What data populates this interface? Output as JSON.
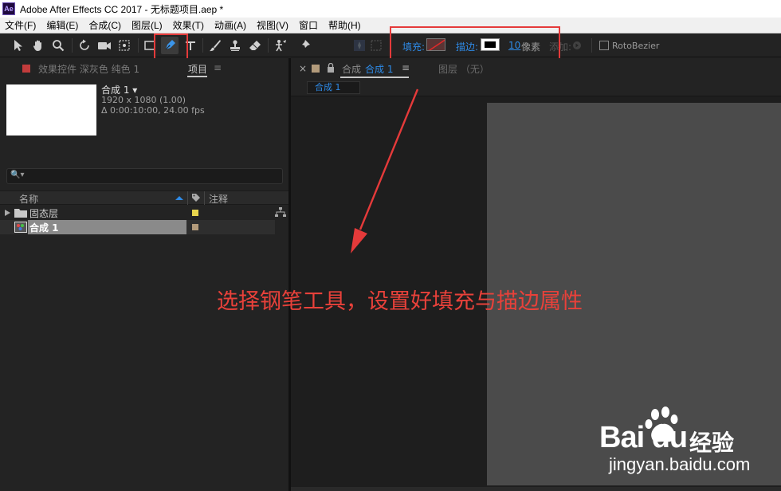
{
  "window": {
    "app_icon": "Ae",
    "title": "Adobe After Effects CC 2017 - 无标题项目.aep *"
  },
  "menu": {
    "items": [
      "文件(F)",
      "编辑(E)",
      "合成(C)",
      "图层(L)",
      "效果(T)",
      "动画(A)",
      "视图(V)",
      "窗口",
      "帮助(H)"
    ]
  },
  "toolbar": {
    "tools": [
      "selection-tool-icon",
      "hand-tool-icon",
      "zoom-tool-icon",
      "rotate-tool-icon",
      "camera-tool-icon",
      "pan-behind-tool-icon",
      "rectangle-tool-icon",
      "pen-tool-icon",
      "type-tool-icon",
      "brush-tool-icon",
      "clone-stamp-tool-icon",
      "eraser-tool-icon",
      "roto-brush-tool-icon",
      "puppet-pin-tool-icon"
    ],
    "active_tool": "pen-tool-icon",
    "fill_label": "填充:",
    "stroke_label": "描边:",
    "stroke_width": "10",
    "stroke_unit": "像素",
    "add_label": "添加:",
    "rotobezier_label": "RotoBezier"
  },
  "left_panel": {
    "tab_effects": "效果控件 深灰色 纯色 1",
    "tab_project": "项目",
    "menu_glyph": "≡",
    "preview": {
      "name": "合成 1 ▾",
      "resolution": "1920 x 1080 (1.00)",
      "duration": "Δ 0:00:10:00, 24.00 fps"
    },
    "search_icon": "🔍▾",
    "columns": {
      "name": "名称",
      "comment": "注释"
    },
    "rows": [
      {
        "name": "固态层",
        "type": "folder",
        "label_color": "#e8d44d"
      },
      {
        "name": "合成 1",
        "type": "composition",
        "label_color": "#b39b7b"
      }
    ]
  },
  "right_panel": {
    "close": "×",
    "tab_comp_prefix": "合成",
    "tab_comp_name": "合成 1",
    "tab_menu": "≡",
    "tab_layer": "图层 （无）",
    "comp_pill": "合成 1"
  },
  "annotation": "选择钢笔工具，设置好填充与描边属性",
  "watermark": {
    "brand": "Bai du",
    "product": "经验",
    "url": "jingyan.baidu.com"
  },
  "colors": {
    "accent": "#2e8ae6",
    "annotation": "#e53a3a",
    "canvas": "#4b4b4b"
  }
}
